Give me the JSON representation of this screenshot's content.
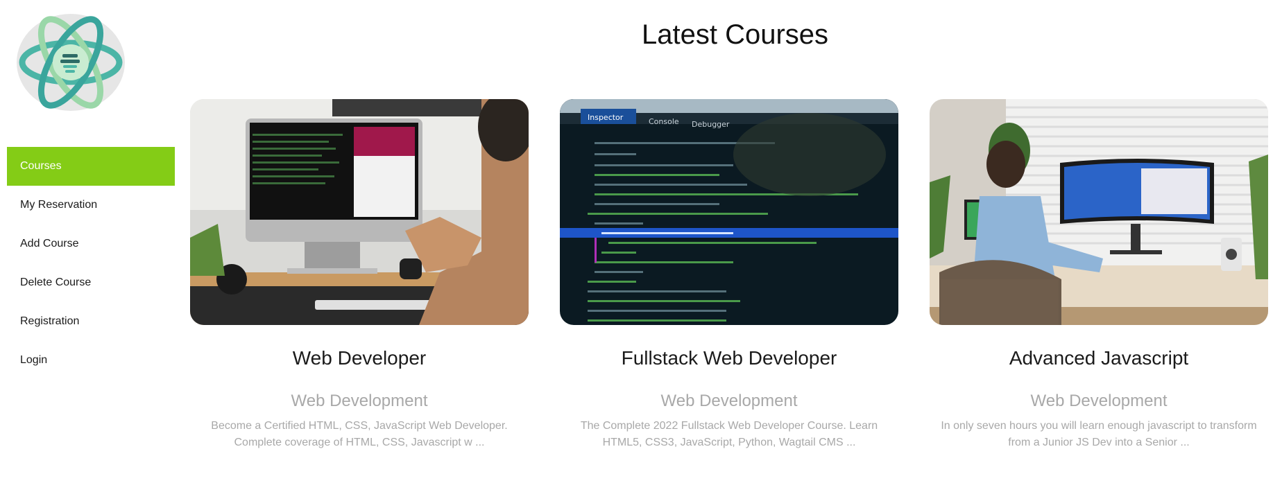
{
  "sidebar": {
    "logo_icon": "atom-logo-icon",
    "items": [
      {
        "label": "Courses",
        "active": true
      },
      {
        "label": "My Reservation",
        "active": false
      },
      {
        "label": "Add Course",
        "active": false
      },
      {
        "label": "Delete Course",
        "active": false
      },
      {
        "label": "Registration",
        "active": false
      },
      {
        "label": "Login",
        "active": false
      }
    ]
  },
  "main": {
    "title": "Latest Courses",
    "courses": [
      {
        "title": "Web Developer",
        "category": "Web Development",
        "description": "Become a Certified HTML, CSS, JavaScript Web Developer. Complete coverage of HTML, CSS, Javascript w ...",
        "image": "person-at-imac-photo"
      },
      {
        "title": "Fullstack Web Developer",
        "category": "Web Development",
        "description": "The Complete 2022 Fullstack Web Developer Course. Learn HTML5, CSS3, JavaScript, Python, Wagtail CMS ...",
        "image": "code-inspector-photo"
      },
      {
        "title": "Advanced Javascript",
        "category": "Web Development",
        "description": "In only seven hours you will learn enough javascript to transform from a Junior JS Dev into a Senior ...",
        "image": "man-at-desk-monitors-photo"
      }
    ]
  },
  "colors": {
    "accent": "#84cc16",
    "muted_text": "#a8a8a8"
  }
}
